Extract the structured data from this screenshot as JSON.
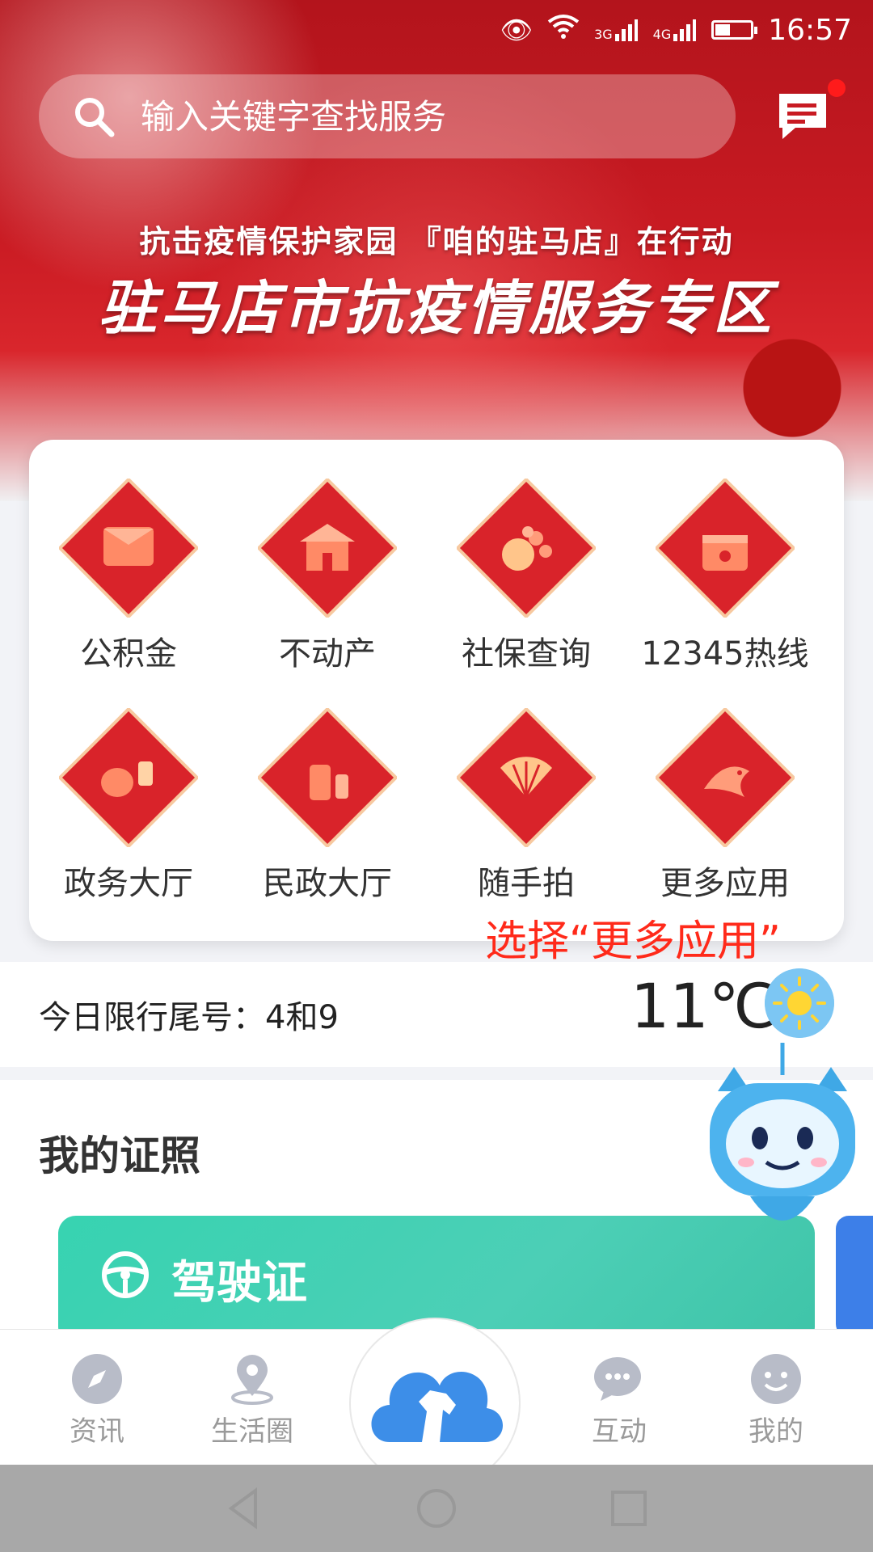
{
  "status_bar": {
    "time": "16:57",
    "network1": "3G",
    "network2": "4G"
  },
  "search": {
    "placeholder": "输入关键字查找服务"
  },
  "banner": {
    "subtitle": "抗击疫情保护家园 『咱的驻马店』在行动",
    "title": "驻马店市抗疫情服务专区"
  },
  "services": [
    {
      "label": "公积金",
      "icon": "red-envelope-icon"
    },
    {
      "label": "不动产",
      "icon": "house-icon"
    },
    {
      "label": "社保查询",
      "icon": "lucky-bag-icon"
    },
    {
      "label": "12345热线",
      "icon": "drum-icon"
    },
    {
      "label": "政务大厅",
      "icon": "lantern-icon"
    },
    {
      "label": "民政大厅",
      "icon": "firecracker-icon"
    },
    {
      "label": "随手拍",
      "icon": "fan-icon"
    },
    {
      "label": "更多应用",
      "icon": "koi-fish-icon"
    }
  ],
  "annotation": "选择“更多应用”",
  "info": {
    "limit": "今日限行尾号：4和9",
    "temperature": "11℃",
    "weather_icon": "sunny-icon"
  },
  "licenses": {
    "section_title": "我的证照",
    "card_title": "驾驶证"
  },
  "tabs": [
    {
      "label": "资讯",
      "icon": "compass-icon"
    },
    {
      "label": "生活圈",
      "icon": "location-pin-icon"
    },
    {
      "label": "",
      "icon": "cloud-horse-logo"
    },
    {
      "label": "互动",
      "icon": "chat-icon"
    },
    {
      "label": "我的",
      "icon": "smile-icon"
    }
  ],
  "colors": {
    "brand_red": "#c81a22",
    "accent_blue": "#3d8ee8",
    "license_green": "#3fcfb0",
    "note_red": "#ff2a1a"
  }
}
